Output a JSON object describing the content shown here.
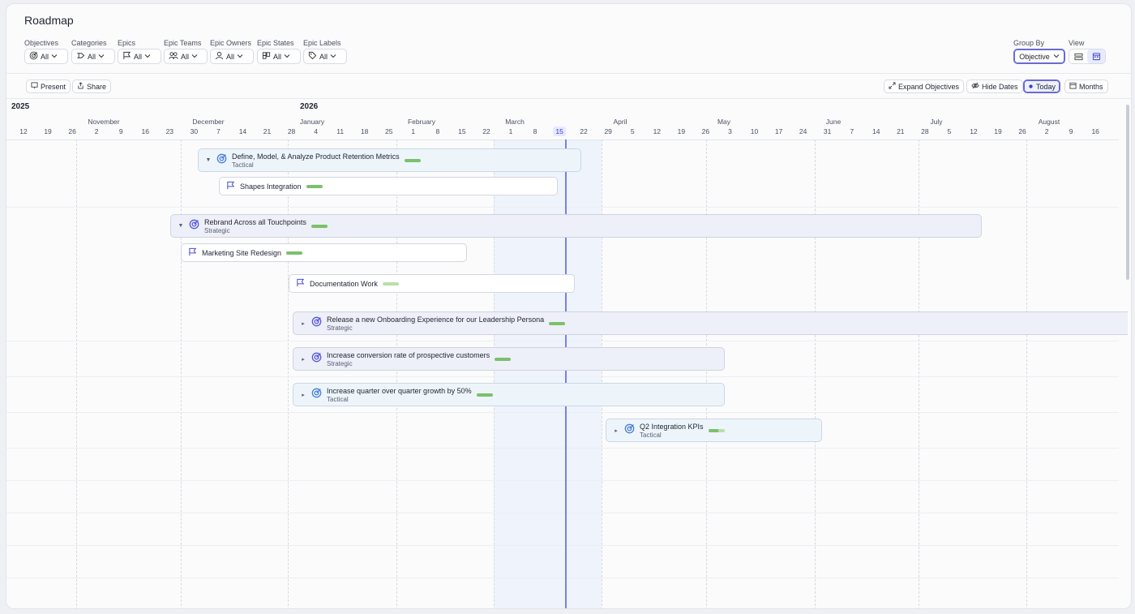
{
  "page": {
    "title": "Roadmap"
  },
  "filters": [
    {
      "label": "Objectives",
      "value": "All",
      "icon": "target-icon"
    },
    {
      "label": "Categories",
      "value": "All",
      "icon": "tag-outline-icon"
    },
    {
      "label": "Epics",
      "value": "All",
      "icon": "flag-icon"
    },
    {
      "label": "Epic Teams",
      "value": "All",
      "icon": "team-icon"
    },
    {
      "label": "Epic Owners",
      "value": "All",
      "icon": "user-icon"
    },
    {
      "label": "Epic States",
      "value": "All",
      "icon": "board-icon"
    },
    {
      "label": "Epic Labels",
      "value": "All",
      "icon": "label-icon"
    }
  ],
  "group_by": {
    "label": "Group By",
    "value": "Objective"
  },
  "view": {
    "label": "View"
  },
  "toolbar": {
    "present": "Present",
    "share": "Share",
    "expand": "Expand Objectives",
    "hide_dates": "Hide Dates",
    "today": "Today",
    "months": "Months"
  },
  "timeline": {
    "years": [
      "2025",
      "2026"
    ],
    "months": [
      "November",
      "December",
      "January",
      "February",
      "March",
      "April",
      "May",
      "June",
      "July",
      "August"
    ],
    "days": [
      "12",
      "19",
      "26",
      "2",
      "9",
      "16",
      "23",
      "30",
      "7",
      "14",
      "21",
      "28",
      "4",
      "11",
      "18",
      "25",
      "1",
      "8",
      "15",
      "22",
      "1",
      "8",
      "15",
      "22",
      "29",
      "5",
      "12",
      "19",
      "26",
      "3",
      "10",
      "17",
      "24",
      "31",
      "7",
      "14",
      "21",
      "28",
      "5",
      "12",
      "19",
      "26",
      "2",
      "9",
      "16"
    ],
    "today_day": "15"
  },
  "rows": [
    {
      "type": "objective",
      "name": "Define, Model, & Analyze Product Retention Metrics",
      "category": "Tactical",
      "expanded": true,
      "progress": "full"
    },
    {
      "type": "epic",
      "name": "Shapes Integration",
      "progress": "full"
    },
    {
      "type": "objective",
      "name": "Rebrand Across all Touchpoints",
      "category": "Strategic",
      "expanded": true,
      "progress": "full"
    },
    {
      "type": "epic",
      "name": "Marketing Site Redesign",
      "progress": "full"
    },
    {
      "type": "epic",
      "name": "Documentation Work",
      "progress": "light"
    },
    {
      "type": "objective",
      "name": "Release a new Onboarding Experience for our Leadership Persona",
      "category": "Strategic",
      "expanded": false,
      "progress": "full"
    },
    {
      "type": "objective",
      "name": "Increase conversion rate of prospective customers",
      "category": "Strategic",
      "expanded": false,
      "progress": "full"
    },
    {
      "type": "objective",
      "name": "Increase quarter over quarter growth by 50%",
      "category": "Tactical",
      "expanded": false,
      "progress": "full"
    },
    {
      "type": "objective",
      "name": "Q2 Integration KPIs",
      "category": "Tactical",
      "expanded": false,
      "progress": "part"
    }
  ],
  "colors": {
    "accent": "#6a6ad6",
    "progress": "#7cc06a",
    "today_line": "#7b7fe0"
  }
}
